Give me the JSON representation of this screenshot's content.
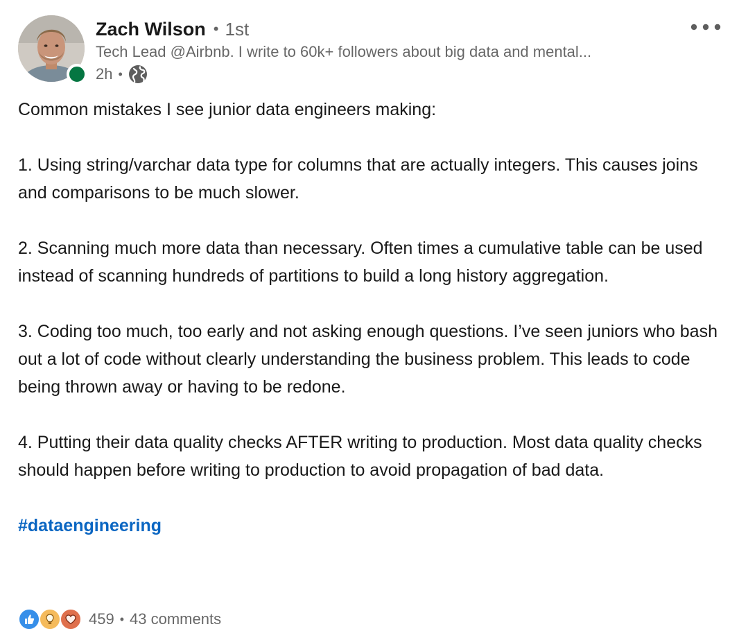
{
  "author": {
    "name": "Zach Wilson",
    "degree": "1st",
    "separator": "•",
    "headline": "Tech Lead @Airbnb. I write to 60k+ followers about big data and mental...",
    "time": "2h",
    "time_separator": "•",
    "visibility_icon": "globe-icon",
    "presence": "online",
    "presence_color": "#057642"
  },
  "post": {
    "intro": "Common mistakes I see junior data engineers making:",
    "points": [
      "1. Using string/varchar data type for columns that are actually integers. This causes joins and comparisons to be much slower.",
      "2. Scanning much more data than necessary. Often times a cumulative table can be used instead of scanning hundreds of partitions to build a long history aggregation.",
      "3. Coding too much, too early and not asking enough questions. I’ve seen juniors who bash out a lot of code without clearly understanding the business problem. This leads to code being thrown away or having to be redone.",
      "4. Putting their data quality checks AFTER writing to production. Most data quality checks should happen before writing to production to avoid propagation of bad data."
    ],
    "hashtag": "#dataengineering"
  },
  "social": {
    "reaction_icons": [
      "like-icon",
      "insightful-icon",
      "love-icon"
    ],
    "reaction_count": "459",
    "separator": "•",
    "comments": "43 comments"
  },
  "colors": {
    "link": "#0a66c2",
    "like": "#378fe9",
    "insightful": "#f5bb5c",
    "love": "#df704d"
  }
}
